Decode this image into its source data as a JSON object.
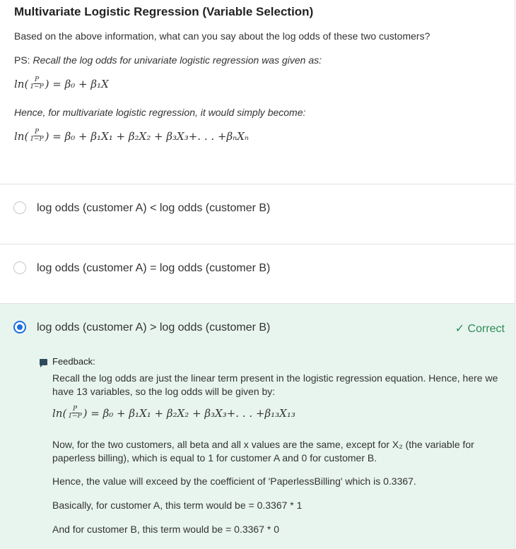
{
  "question": {
    "title": "Multivariate Logistic Regression (Variable Selection)",
    "text": "Based on the above information, what can you say about the log odds of these two customers?",
    "ps_prefix": "PS: ",
    "ps_italic": "Recall the log odds for univariate logistic regression was given as:",
    "hence": "Hence, for multivariate logistic regression, it would simply become:"
  },
  "formulas": {
    "univariate": {
      "lhs": "ln(",
      "num": "P",
      "den": "1−P",
      "rhs": ") = β₀ + β₁X"
    },
    "multivariate": {
      "lhs": "ln(",
      "num": "P",
      "den": "1−P",
      "rhs": ") = β₀ + β₁X₁ + β₂X₂ + β₃X₃+. . . +βₙXₙ"
    },
    "feedback": {
      "lhs": "ln(",
      "num": "P",
      "den": "1−P",
      "rhs": ") = β₀ + β₁X₁ + β₂X₂ + β₃X₃+. . . +β₁₃X₁₃"
    }
  },
  "options": [
    {
      "label": "log odds (customer A) < log odds (customer B)",
      "selected": false
    },
    {
      "label": "log odds (customer A) = log odds (customer B)",
      "selected": false
    },
    {
      "label": "log odds (customer A) > log odds (customer B)",
      "selected": true
    }
  ],
  "result": {
    "label": "✓ Correct",
    "color": "#2e8a57"
  },
  "feedback": {
    "heading": "Feedback:",
    "p1": "Recall the log odds are just the linear term present in the logistic regression equation. Hence, here we have 13 variables, so the log odds will be given by:",
    "p2": "Now, for the two customers, all beta and all x values are the same, except for X₂ (the variable for paperless billing), which is equal to 1 for customer A and 0 for customer B.",
    "p3": "Hence, the value will exceed by the coefficient of 'PaperlessBilling' which is 0.3367.",
    "p4": "Basically, for customer A, this term would be = 0.3367 * 1",
    "p5": "And for customer B, this term would be = 0.3367 * 0"
  },
  "colors": {
    "selected_bg": "#e8f5ee",
    "radio_accent": "#1d6fe0"
  },
  "icons": {
    "feedback": "chat-bubble-icon",
    "correct": "checkmark-icon"
  }
}
